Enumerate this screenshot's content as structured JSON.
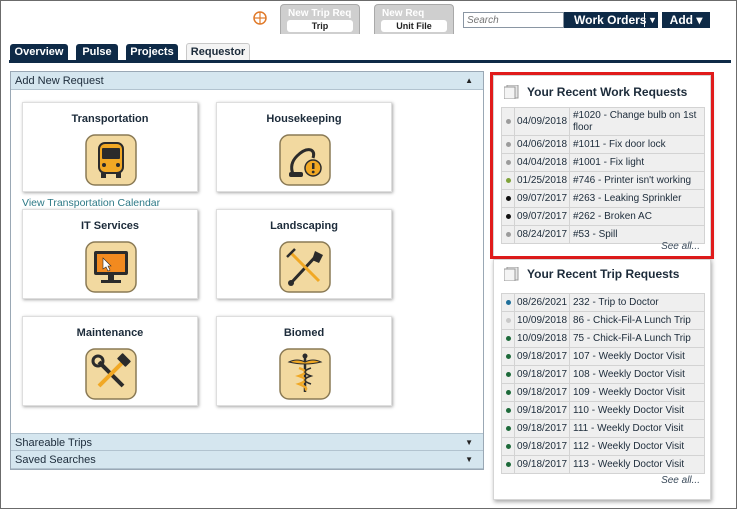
{
  "topbar": {
    "quick_tabs": [
      {
        "title": "New Trip Req",
        "sub": "Trip"
      },
      {
        "title": "New Req",
        "sub": "Unit File"
      }
    ],
    "search_placeholder": "Search",
    "work_orders_label": "Work Orders",
    "add_label": "Add ▾"
  },
  "nav": {
    "tabs": [
      "Overview",
      "Pulse",
      "Projects",
      "Requestor"
    ],
    "active": "Requestor"
  },
  "left": {
    "section_title": "Add New Request",
    "cards": [
      {
        "label": "Transportation",
        "icon": "bus-icon"
      },
      {
        "label": "Housekeeping",
        "icon": "vacuum-icon"
      },
      {
        "label": "IT Services",
        "icon": "monitor-icon"
      },
      {
        "label": "Landscaping",
        "icon": "shovel-rake-icon"
      },
      {
        "label": "Maintenance",
        "icon": "wrench-hammer-icon"
      },
      {
        "label": "Biomed",
        "icon": "caduceus-icon"
      }
    ],
    "transport_link": "View Transportation Calendar",
    "collapsed_sections": [
      "Shareable Trips",
      "Saved Searches"
    ]
  },
  "work_requests": {
    "title": "Your Recent Work Requests",
    "see_all": "See all...",
    "rows": [
      {
        "status_color": "#9c9c9c",
        "date": "04/09/2018",
        "desc": "#1020 - Change bulb on 1st floor"
      },
      {
        "status_color": "#9c9c9c",
        "date": "04/06/2018",
        "desc": "#1011 - Fix door lock"
      },
      {
        "status_color": "#9c9c9c",
        "date": "04/04/2018",
        "desc": "#1001 - Fix light"
      },
      {
        "status_color": "#7fa33a",
        "date": "01/25/2018",
        "desc": "#746 - Printer isn't working"
      },
      {
        "status_color": "#111111",
        "date": "09/07/2017",
        "desc": "#263 - Leaking Sprinkler"
      },
      {
        "status_color": "#111111",
        "date": "09/07/2017",
        "desc": "#262 - Broken AC"
      },
      {
        "status_color": "#9c9c9c",
        "date": "08/24/2017",
        "desc": "#53 - Spill"
      }
    ]
  },
  "trip_requests": {
    "title": "Your Recent Trip Requests",
    "see_all": "See all...",
    "rows": [
      {
        "status_color": "#1f6f9a",
        "date": "08/26/2021",
        "desc": "232 - Trip to Doctor"
      },
      {
        "status_color": "#c9c9c9",
        "date": "10/09/2018",
        "desc": "86 - Chick-Fil-A Lunch Trip"
      },
      {
        "status_color": "#1d6a3a",
        "date": "10/09/2018",
        "desc": "75 - Chick-Fil-A Lunch Trip"
      },
      {
        "status_color": "#1d6a3a",
        "date": "09/18/2017",
        "desc": "107 - Weekly Doctor Visit"
      },
      {
        "status_color": "#1d6a3a",
        "date": "09/18/2017",
        "desc": "108 - Weekly Doctor Visit"
      },
      {
        "status_color": "#1d6a3a",
        "date": "09/18/2017",
        "desc": "109 - Weekly Doctor Visit"
      },
      {
        "status_color": "#1d6a3a",
        "date": "09/18/2017",
        "desc": "110 - Weekly Doctor Visit"
      },
      {
        "status_color": "#1d6a3a",
        "date": "09/18/2017",
        "desc": "111 - Weekly Doctor Visit"
      },
      {
        "status_color": "#1d6a3a",
        "date": "09/18/2017",
        "desc": "112 - Weekly Doctor Visit"
      },
      {
        "status_color": "#1d6a3a",
        "date": "09/18/2017",
        "desc": "113 - Weekly Doctor Visit"
      }
    ]
  },
  "colors": {
    "navy": "#0e2a47",
    "highlight": "#e01b1b",
    "icon_tile": "#f2d9a0"
  }
}
